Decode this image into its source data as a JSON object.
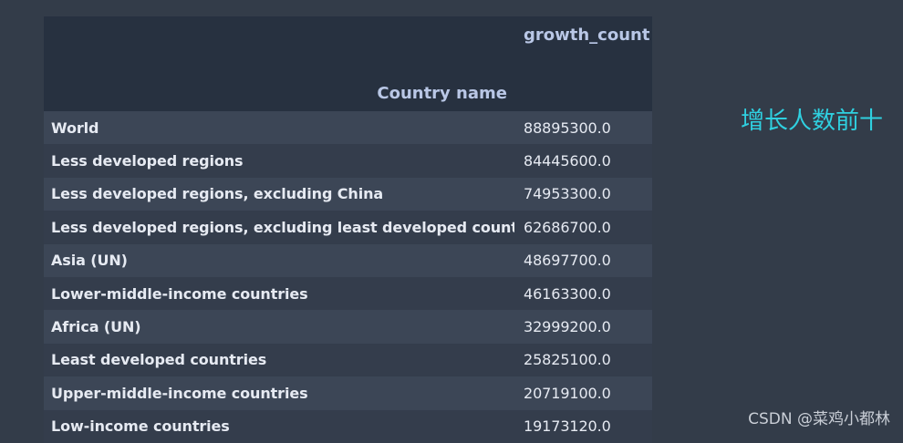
{
  "table": {
    "value_column_header": "growth_count",
    "index_name": "Country name",
    "rows": [
      {
        "name": "World",
        "value": "88895300.0"
      },
      {
        "name": "Less developed regions",
        "value": "84445600.0"
      },
      {
        "name": "Less developed regions, excluding China",
        "value": "74953300.0"
      },
      {
        "name": "Less developed regions, excluding least developed countries",
        "value": "62686700.0"
      },
      {
        "name": "Asia (UN)",
        "value": "48697700.0"
      },
      {
        "name": "Lower-middle-income countries",
        "value": "46163300.0"
      },
      {
        "name": "Africa (UN)",
        "value": "32999200.0"
      },
      {
        "name": "Least developed countries",
        "value": "25825100.0"
      },
      {
        "name": "Upper-middle-income countries",
        "value": "20719100.0"
      },
      {
        "name": "Low-income countries",
        "value": "19173120.0"
      }
    ]
  },
  "annotation": "增长人数前十",
  "watermark": "CSDN @菜鸡小都林",
  "colors": {
    "background": "#333c49",
    "header_bg": "#273140",
    "row_odd": "#3c4656",
    "row_even": "#343d4c",
    "header_text": "#b9c7e6",
    "annotation": "#2fd0e0"
  }
}
